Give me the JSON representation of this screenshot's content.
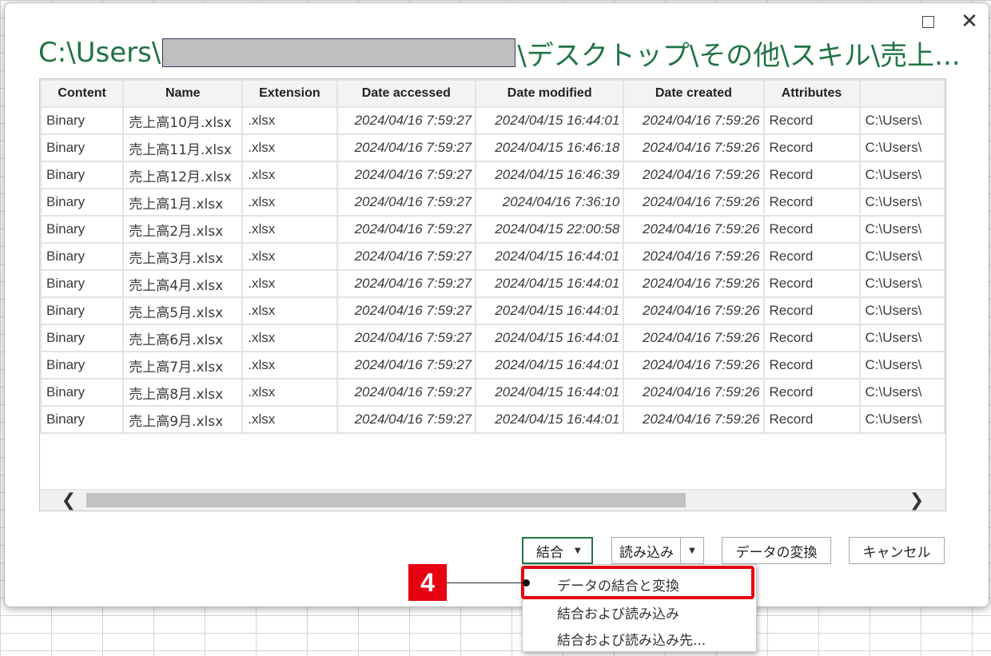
{
  "title": {
    "prefix": "C:\\Users\\",
    "suffix": "\\デスクトップ\\その他\\スキル\\売上..."
  },
  "window": {
    "maximize_icon": "maximize-icon",
    "close_glyph": "✕"
  },
  "table": {
    "columns": [
      "Content",
      "Name",
      "Extension",
      "Date accessed",
      "Date modified",
      "Date created",
      "Attributes",
      ""
    ],
    "rows": [
      [
        "Binary",
        "売上高10月.xlsx",
        ".xlsx",
        "2024/04/16 7:59:27",
        "2024/04/15 16:44:01",
        "2024/04/16 7:59:26",
        "Record",
        "C:\\Users\\"
      ],
      [
        "Binary",
        "売上高11月.xlsx",
        ".xlsx",
        "2024/04/16 7:59:27",
        "2024/04/15 16:46:18",
        "2024/04/16 7:59:26",
        "Record",
        "C:\\Users\\"
      ],
      [
        "Binary",
        "売上高12月.xlsx",
        ".xlsx",
        "2024/04/16 7:59:27",
        "2024/04/15 16:46:39",
        "2024/04/16 7:59:26",
        "Record",
        "C:\\Users\\"
      ],
      [
        "Binary",
        "売上高1月.xlsx",
        ".xlsx",
        "2024/04/16 7:59:27",
        "2024/04/16 7:36:10",
        "2024/04/16 7:59:26",
        "Record",
        "C:\\Users\\"
      ],
      [
        "Binary",
        "売上高2月.xlsx",
        ".xlsx",
        "2024/04/16 7:59:27",
        "2024/04/15 22:00:58",
        "2024/04/16 7:59:26",
        "Record",
        "C:\\Users\\"
      ],
      [
        "Binary",
        "売上高3月.xlsx",
        ".xlsx",
        "2024/04/16 7:59:27",
        "2024/04/15 16:44:01",
        "2024/04/16 7:59:26",
        "Record",
        "C:\\Users\\"
      ],
      [
        "Binary",
        "売上高4月.xlsx",
        ".xlsx",
        "2024/04/16 7:59:27",
        "2024/04/15 16:44:01",
        "2024/04/16 7:59:26",
        "Record",
        "C:\\Users\\"
      ],
      [
        "Binary",
        "売上高5月.xlsx",
        ".xlsx",
        "2024/04/16 7:59:27",
        "2024/04/15 16:44:01",
        "2024/04/16 7:59:26",
        "Record",
        "C:\\Users\\"
      ],
      [
        "Binary",
        "売上高6月.xlsx",
        ".xlsx",
        "2024/04/16 7:59:27",
        "2024/04/15 16:44:01",
        "2024/04/16 7:59:26",
        "Record",
        "C:\\Users\\"
      ],
      [
        "Binary",
        "売上高7月.xlsx",
        ".xlsx",
        "2024/04/16 7:59:27",
        "2024/04/15 16:44:01",
        "2024/04/16 7:59:26",
        "Record",
        "C:\\Users\\"
      ],
      [
        "Binary",
        "売上高8月.xlsx",
        ".xlsx",
        "2024/04/16 7:59:27",
        "2024/04/15 16:44:01",
        "2024/04/16 7:59:26",
        "Record",
        "C:\\Users\\"
      ],
      [
        "Binary",
        "売上高9月.xlsx",
        ".xlsx",
        "2024/04/16 7:59:27",
        "2024/04/15 16:44:01",
        "2024/04/16 7:59:26",
        "Record",
        "C:\\Users\\"
      ]
    ]
  },
  "scroll": {
    "left_glyph": "❮",
    "right_glyph": "❯"
  },
  "buttons": {
    "combine": "結合",
    "load": "読み込み",
    "transform": "データの変換",
    "cancel": "キャンセル",
    "caret": "▼"
  },
  "combine_menu": {
    "items": [
      "データの結合と変換",
      "結合および読み込み",
      "結合および読み込み先..."
    ]
  },
  "annotation": {
    "step": "4",
    "color": "#e60012"
  },
  "colors": {
    "accent": "#217346"
  }
}
